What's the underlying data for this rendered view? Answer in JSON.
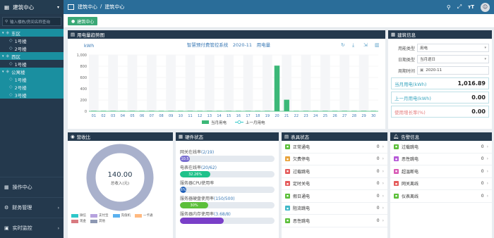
{
  "sidebar": {
    "title": "建筑中心",
    "search_placeholder": "输入楼栋/房间名称查询",
    "tree": [
      {
        "label": "东区",
        "level": 1,
        "selected": true
      },
      {
        "label": "1号楼",
        "level": 2,
        "selected": false
      },
      {
        "label": "2号楼",
        "level": 2,
        "selected": false
      },
      {
        "label": "西区",
        "level": 1,
        "selected": true
      },
      {
        "label": "1号楼",
        "level": 2,
        "selected": false
      },
      {
        "label": "公寓楼",
        "level": 1,
        "selected": true
      },
      {
        "label": "1号楼",
        "level": 2,
        "selected": true
      },
      {
        "label": "2号楼",
        "level": 2,
        "selected": true
      },
      {
        "label": "3号楼",
        "level": 2,
        "selected": true
      }
    ],
    "bottom_menu": [
      "操作中心",
      "财务管理",
      "实时监控"
    ]
  },
  "topbar": {
    "crumb1": "建筑中心",
    "sep": "/",
    "crumb2": "建筑中心"
  },
  "tab": {
    "label": "建筑中心"
  },
  "usage": {
    "title": "用电量趋势图",
    "toolbar_title": "智慧预付费管控系统　2020-11　用电量",
    "legend_current": "当月用电",
    "legend_previous": "上一月用电"
  },
  "chart_data": {
    "type": "bar",
    "ylabel": "kWh",
    "ylim": [
      0,
      1000
    ],
    "yticks": [
      0,
      200,
      400,
      600,
      800,
      1000
    ],
    "categories": [
      "01",
      "02",
      "03",
      "04",
      "05",
      "06",
      "07",
      "08",
      "09",
      "10",
      "11",
      "12",
      "13",
      "14",
      "15",
      "16",
      "17",
      "18",
      "19",
      "20",
      "21",
      "22",
      "23",
      "24",
      "25",
      "26",
      "27",
      "28",
      "29",
      "30"
    ],
    "series": [
      {
        "name": "当月用电",
        "color": "#3cb878",
        "values": [
          8,
          8,
          8,
          8,
          8,
          8,
          8,
          8,
          8,
          8,
          8,
          8,
          8,
          8,
          8,
          8,
          8,
          8,
          8,
          810,
          205,
          8,
          8,
          8,
          8,
          8,
          8,
          8,
          8,
          8
        ]
      },
      {
        "name": "上一月用电",
        "color": "#2ec7c9",
        "values": [
          0,
          0,
          0,
          0,
          0,
          0,
          0,
          0,
          0,
          0,
          0,
          0,
          0,
          0,
          0,
          0,
          0,
          0,
          0,
          0,
          0,
          0,
          0,
          0,
          0,
          0,
          0,
          0,
          0,
          0
        ]
      }
    ]
  },
  "building": {
    "title": "建筑信息",
    "type_label": "用能类型",
    "type_value": "用电",
    "period_label": "日期类型",
    "period_value": "当月逐日",
    "time_label": "周期时间",
    "time_value": "2020-11",
    "stats": [
      {
        "label": "当月用电(kWh)",
        "value": "1,016.89",
        "red": false
      },
      {
        "label": "上一月用电(kWh)",
        "value": "0.00",
        "red": false
      },
      {
        "label": "使用增长率(%)",
        "value": "0.00",
        "red": true
      }
    ]
  },
  "ratio": {
    "title": "营收比",
    "total": "140.00",
    "total_label": "总收入(元)",
    "legend": [
      {
        "label": "微信",
        "color": "#2ec7c9"
      },
      {
        "label": "支付宝",
        "color": "#b6a2de"
      },
      {
        "label": "充值机",
        "color": "#5ab1ef"
      },
      {
        "label": "一卡通",
        "color": "#ffb980"
      },
      {
        "label": "现金",
        "color": "#d87a80"
      },
      {
        "label": "其他",
        "color": "#8d98b3"
      }
    ]
  },
  "hardware": {
    "title": "硬件状态",
    "items": [
      {
        "label": "网关在线率",
        "count": "(2/19)",
        "percent": 10.5,
        "text": "10.5",
        "color": "#7a6fd0"
      },
      {
        "label": "电表在线率",
        "count": "(20/62)",
        "percent": 32.26,
        "text": "32.26%",
        "color": "#1fc28a"
      },
      {
        "label": "服务器CPU使用率",
        "count": "",
        "percent": 6,
        "text": "6%",
        "color": "#1f5fb8"
      },
      {
        "label": "服务器硬盘使用率",
        "count": "(150/500)",
        "percent": 30,
        "text": "30%",
        "color": "#5cbf3a"
      },
      {
        "label": "服务器内存使用率",
        "count": "(3.68/8)",
        "percent": 46,
        "text": "",
        "color": "#7a3fc8"
      }
    ]
  },
  "meter": {
    "title": "表具状态",
    "items": [
      {
        "label": "正常通电",
        "count": "0",
        "color": "#5cbf3a",
        "icon": "check-icon"
      },
      {
        "label": "欠费停电",
        "count": "0",
        "color": "#e8a33b",
        "icon": "yen-icon"
      },
      {
        "label": "过载跳电",
        "count": "0",
        "color": "#e45b5b",
        "icon": "x-icon"
      },
      {
        "label": "定时关电",
        "count": "0",
        "color": "#e45b5b",
        "icon": "clock-icon"
      },
      {
        "label": "假日通电",
        "count": "0",
        "color": "#5cbf3a",
        "icon": "calendar-icon"
      },
      {
        "label": "阻流跳电",
        "count": "0",
        "color": "#3fb8c8",
        "icon": "wave-icon"
      },
      {
        "label": "恶性跳电",
        "count": "0",
        "color": "#5cbf3a",
        "icon": "bolt-icon"
      }
    ]
  },
  "alarm": {
    "title": "告警信息",
    "items": [
      {
        "label": "过载跳电",
        "count": "0",
        "color": "#5cbf3a",
        "icon": "overload-icon"
      },
      {
        "label": "恶性跳电",
        "count": "0",
        "color": "#b65ad8",
        "icon": "malicious-icon"
      },
      {
        "label": "超温断电",
        "count": "0",
        "color": "#d85ab6",
        "icon": "temperature-icon"
      },
      {
        "label": "网关离线",
        "count": "0",
        "color": "#e45b5b",
        "icon": "gateway-icon"
      },
      {
        "label": "仪表离线",
        "count": "0",
        "color": "#5cbf3a",
        "icon": "meter-icon"
      }
    ]
  }
}
